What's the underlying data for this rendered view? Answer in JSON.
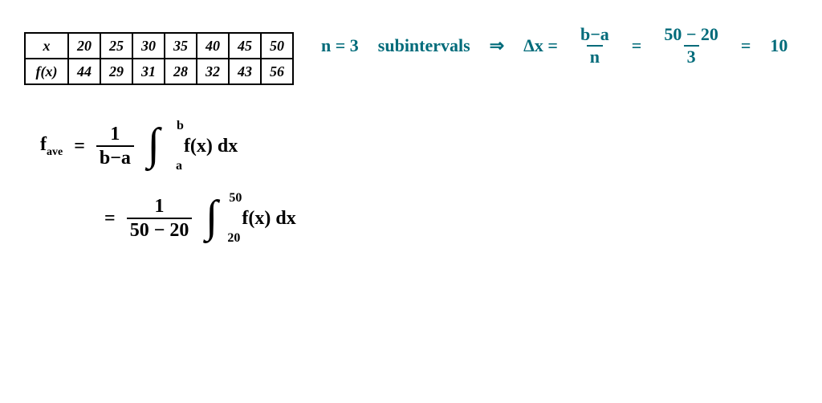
{
  "table": {
    "row1_hdr": "x",
    "row1": [
      "20",
      "25",
      "30",
      "35",
      "40",
      "45",
      "50"
    ],
    "row2_hdr": "f(x)",
    "row2": [
      "44",
      "29",
      "31",
      "28",
      "32",
      "43",
      "56"
    ]
  },
  "line1": {
    "lhs_f": "f",
    "lhs_sub": "ave",
    "eq": "=",
    "frac_num": "1",
    "frac_den": "b−a",
    "int_ub": "b",
    "int_lb": "a",
    "integrand": "f(x) dx"
  },
  "line2": {
    "eq": "=",
    "frac_num": "1",
    "frac_den": "50 − 20",
    "int_ub": "50",
    "int_lb": "20",
    "integrand": "f(x) dx"
  },
  "teal": {
    "n_text": "n = 3",
    "sublabel": "subintervals",
    "arrow": "⇒",
    "dx": "Δx =",
    "frac1_num": "b−a",
    "frac1_den": "n",
    "eq1": "=",
    "frac2_num": "50 − 20",
    "frac2_den": "3",
    "eq2": "=",
    "result": "10"
  }
}
